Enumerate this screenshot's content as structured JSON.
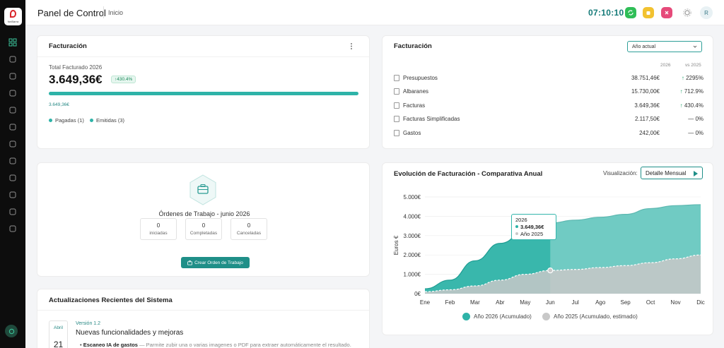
{
  "sidebar": {
    "logo_text": "fonBarra",
    "icons": [
      "grid-icon",
      "users-icon",
      "box-icon",
      "package-icon",
      "document-icon",
      "fan-icon",
      "recycle-icon",
      "gear-icon",
      "power-icon",
      "stack-icon",
      "shield-icon",
      "globe-icon"
    ]
  },
  "header": {
    "title": "Panel de Control",
    "breadcrumb": "Inicio",
    "clock": "07:10:10",
    "avatar_initial": "R"
  },
  "billing_summary": {
    "title": "Facturación",
    "total_label": "Total Facturado 2026",
    "total_value": "3.649,36€",
    "change_badge": "↑430.4%",
    "progress_fraction": 1.0,
    "progress_value": "3.649,36€",
    "legend": [
      {
        "label": "Pagadas",
        "count": "(1)",
        "color": "#2eb3a8"
      },
      {
        "label": "Emitidas",
        "count": "(3)",
        "color": "#2eb3a8"
      }
    ]
  },
  "billing_table": {
    "title": "Facturación",
    "select_value": "Año actual",
    "col_year": "2026",
    "col_compare": "vs 2025",
    "rows": [
      {
        "name": "Presupuestos",
        "value": "38.751,46€",
        "arrow": "↑",
        "pct": "2295%"
      },
      {
        "name": "Albaranes",
        "value": "15.730,00€",
        "arrow": "↑",
        "pct": "712.9%"
      },
      {
        "name": "Facturas",
        "value": "3.649,36€",
        "arrow": "↑",
        "pct": "430.4%"
      },
      {
        "name": "Facturas Simplificadas",
        "value": "2.117,50€",
        "arrow": "—",
        "pct": "0%"
      },
      {
        "name": "Gastos",
        "value": "242,00€",
        "arrow": "—",
        "pct": "0%"
      }
    ]
  },
  "work_orders": {
    "title": "Órdenes de Trabajo - junio 2026",
    "stats": [
      {
        "value": "0",
        "label": "iniciadas"
      },
      {
        "value": "0",
        "label": "Completadas"
      },
      {
        "value": "0",
        "label": "Canceladas"
      }
    ],
    "create_label": "Crear Orden de Trabajo"
  },
  "updates": {
    "title": "Actualizaciones Recientes del Sistema",
    "month": "Abril",
    "day": "21",
    "version": "Versión 1.2",
    "heading": "Nuevas funcionalidades y mejoras",
    "bullet_bold": "Escaneo IA de gastos",
    "bullet_text": " — Parmite zubir una o varias imagenes o PDF para extraer automáticamente el resultado."
  },
  "chart_panel": {
    "title": "Evolución de Facturación - Comparativa Anual",
    "vis_label": "Visualización:",
    "vis_value": "Detalle Mensual",
    "tooltip": {
      "title": "2026",
      "a": "3.649,36€",
      "b": "Año 2025"
    }
  },
  "chart_data": {
    "type": "area",
    "categories": [
      "Ene",
      "Feb",
      "Mar",
      "Abr",
      "May",
      "Jun",
      "Jul",
      "Ago",
      "Sep",
      "Oct",
      "Nov",
      "Dic"
    ],
    "ylabel": "Euros €",
    "ylim": [
      0,
      5000
    ],
    "yticks": [
      0,
      1000,
      2000,
      3000,
      4000,
      5000
    ],
    "ytick_labels": [
      "0€",
      "1.000€",
      "2.000€",
      "3.000€",
      "4.000€",
      "5.000€"
    ],
    "series": [
      {
        "name": "Año 2026 (Acumulado)",
        "color": "#2eb3a8",
        "values": [
          250,
          700,
          1700,
          2600,
          3200,
          3649,
          3800,
          3950,
          4100,
          4400,
          4550,
          4600
        ]
      },
      {
        "name": "Año 2025 (Acumulado, estimado)",
        "color": "#c8c8c8",
        "values": [
          100,
          200,
          400,
          700,
          1000,
          1200,
          1250,
          1350,
          1450,
          1600,
          1800,
          2000
        ]
      }
    ]
  }
}
